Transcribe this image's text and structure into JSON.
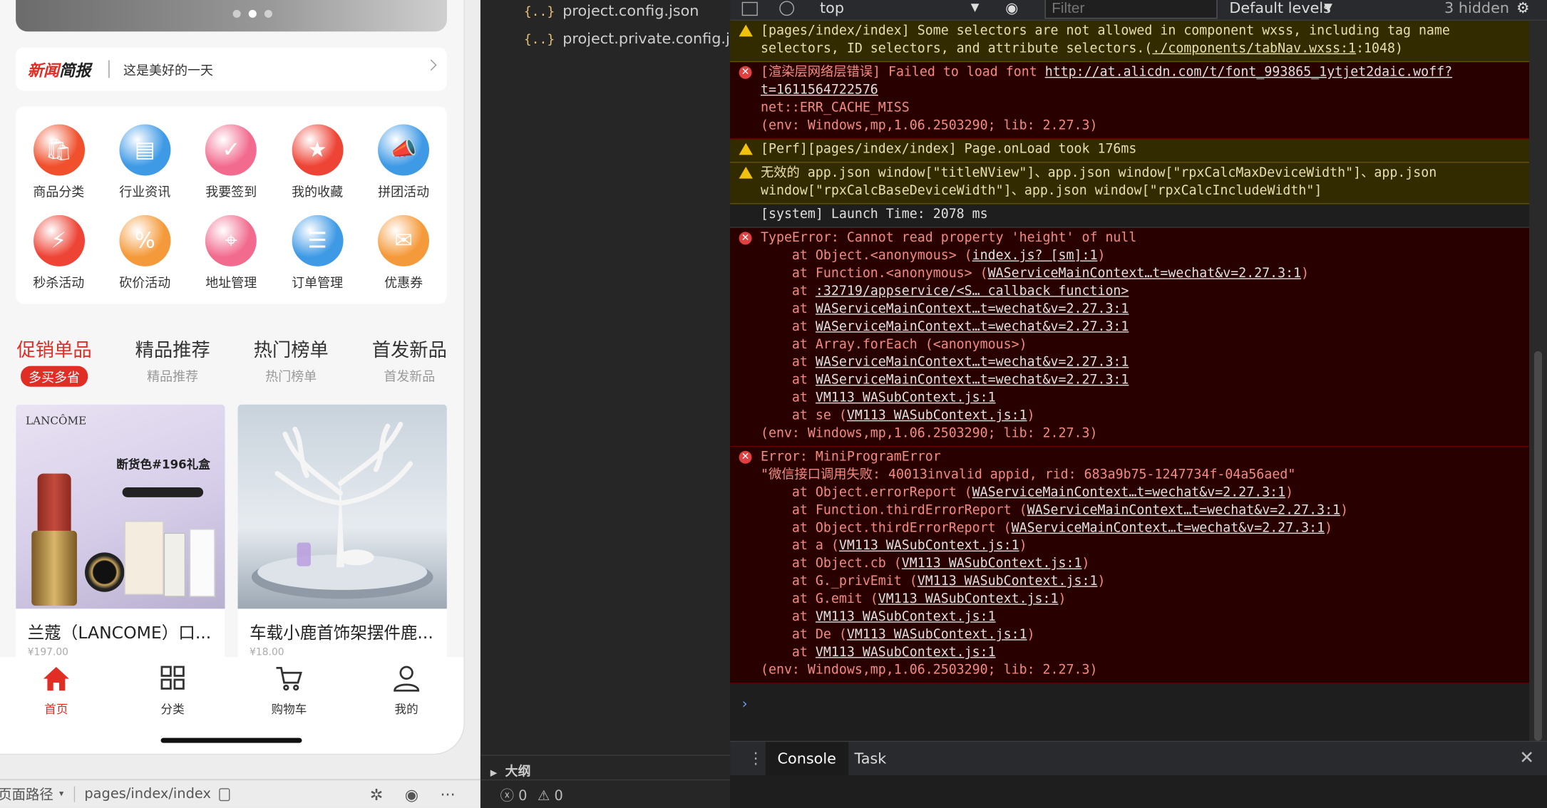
{
  "simulator": {
    "news": {
      "logo_red": "新闻",
      "logo_dark": "简报",
      "text": "这是美好的一天"
    },
    "grid": [
      {
        "label": "商品分类",
        "color": "#f0502c",
        "icon": "bag-icon"
      },
      {
        "label": "行业资讯",
        "color": "#3f9ae6",
        "icon": "news-icon"
      },
      {
        "label": "我要签到",
        "color": "#f26b8f",
        "icon": "calendar-icon"
      },
      {
        "label": "我的收藏",
        "color": "#ee4436",
        "icon": "star-icon"
      },
      {
        "label": "拼团活动",
        "color": "#3f9ae6",
        "icon": "megaphone-icon"
      },
      {
        "label": "秒杀活动",
        "color": "#ee4436",
        "icon": "flash-icon"
      },
      {
        "label": "砍价活动",
        "color": "#f59a3a",
        "icon": "tag-icon"
      },
      {
        "label": "地址管理",
        "color": "#f26b8f",
        "icon": "map-pin-icon"
      },
      {
        "label": "订单管理",
        "color": "#3f9ae6",
        "icon": "order-icon"
      },
      {
        "label": "优惠券",
        "color": "#f59a3a",
        "icon": "coupon-icon"
      }
    ],
    "tabs": [
      {
        "title": "促销单品",
        "sub": "多买多省"
      },
      {
        "title": "精品推荐",
        "sub": "精品推荐"
      },
      {
        "title": "热门榜单",
        "sub": "热门榜单"
      },
      {
        "title": "首发新品",
        "sub": "首发新品"
      }
    ],
    "products": [
      {
        "title": "兰蔻（LANCOME）口...",
        "price": "¥197.00",
        "brand": "LANCÔME",
        "promo": "断货色#196礼盒"
      },
      {
        "title": "车载小鹿首饰架摆件鹿...",
        "price": "¥18.00"
      }
    ],
    "tabbar": [
      {
        "label": "首页",
        "icon": "home-icon"
      },
      {
        "label": "分类",
        "icon": "grid-icon"
      },
      {
        "label": "购物车",
        "icon": "cart-icon"
      },
      {
        "label": "我的",
        "icon": "user-icon"
      }
    ],
    "status": {
      "path_label": "页面路径",
      "path": "pages/index/index"
    }
  },
  "explorer": {
    "files": [
      "project.config.json",
      "project.private.config.js..."
    ],
    "outline": "大纲",
    "errors": "0",
    "warnings": "0"
  },
  "console": {
    "context": "top",
    "filter_placeholder": "Filter",
    "levels": "Default levels",
    "hidden": "3 hidden",
    "messages": [
      {
        "level": "warn",
        "text": "[pages/index/index] Some selectors are not allowed in component wxss, including tag name\nselectors, ID selectors, and attribute selectors.(./components/tabNav.wxss:1:1048)"
      },
      {
        "level": "error",
        "text": "[渲染层网络层错误] Failed to load font http://at.alicdn.com/t/font_993865_1ytjet2daic.woff?\nt=1611564722576\nnet::ERR_CACHE_MISS\n(env: Windows,mp,1.06.2503290; lib: 2.27.3)"
      },
      {
        "level": "warn",
        "text": "[Perf][pages/index/index] Page.onLoad took 176ms"
      },
      {
        "level": "warn",
        "text": "无效的 app.json window[\"titleNView\"]、app.json window[\"rpxCalcMaxDeviceWidth\"]、app.json\nwindow[\"rpxCalcBaseDeviceWidth\"]、app.json window[\"rpxCalcIncludeWidth\"]"
      },
      {
        "level": "info",
        "text": "[system] Launch Time: 2078 ms"
      },
      {
        "level": "error",
        "text": "TypeError: Cannot read property 'height' of null\n    at Object.<anonymous> (index.js? [sm]:1)\n    at Function.<anonymous> (WAServiceMainContext…t=wechat&v=2.27.3:1)\n    at :32719/appservice/<S… callback function>\n    at WAServiceMainContext…t=wechat&v=2.27.3:1\n    at WAServiceMainContext…t=wechat&v=2.27.3:1\n    at Array.forEach (<anonymous>)\n    at WAServiceMainContext…t=wechat&v=2.27.3:1\n    at WAServiceMainContext…t=wechat&v=2.27.3:1\n    at VM113 WASubContext.js:1\n    at se (VM113 WASubContext.js:1)\n(env: Windows,mp,1.06.2503290; lib: 2.27.3)"
      },
      {
        "level": "error",
        "text": "Error: MiniProgramError\n\"微信接口调用失败: 40013invalid appid, rid: 683a9b75-1247734f-04a56aed\"\n    at Object.errorReport (WAServiceMainContext…t=wechat&v=2.27.3:1)\n    at Function.thirdErrorReport (WAServiceMainContext…t=wechat&v=2.27.3:1)\n    at Object.thirdErrorReport (WAServiceMainContext…t=wechat&v=2.27.3:1)\n    at a (VM113 WASubContext.js:1)\n    at Object.cb (VM113 WASubContext.js:1)\n    at G._privEmit (VM113 WASubContext.js:1)\n    at G.emit (VM113 WASubContext.js:1)\n    at VM113 WASubContext.js:1\n    at De (VM113 WASubContext.js:1)\n    at VM113 WASubContext.js:1\n(env: Windows,mp,1.06.2503290; lib: 2.27.3)"
      }
    ],
    "drawer_tabs": [
      "Console",
      "Task"
    ]
  }
}
